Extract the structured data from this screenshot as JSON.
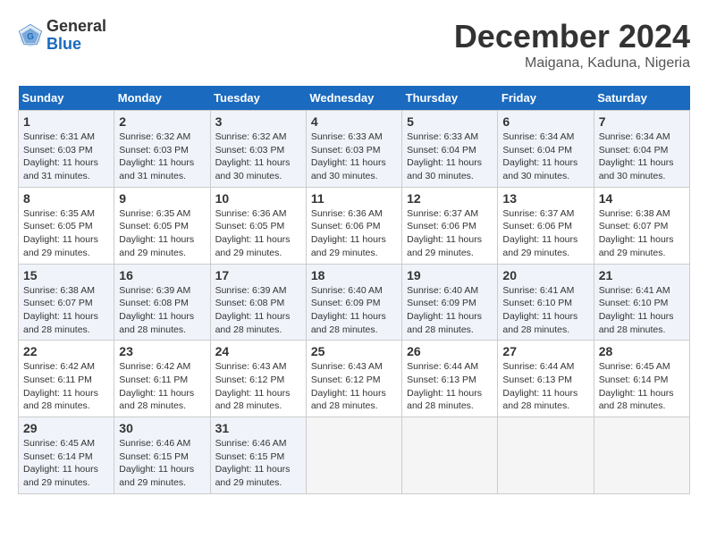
{
  "logo": {
    "general": "General",
    "blue": "Blue"
  },
  "title": {
    "month_year": "December 2024",
    "location": "Maigana, Kaduna, Nigeria"
  },
  "weekdays": [
    "Sunday",
    "Monday",
    "Tuesday",
    "Wednesday",
    "Thursday",
    "Friday",
    "Saturday"
  ],
  "weeks": [
    [
      {
        "day": "1",
        "sunrise": "6:31 AM",
        "sunset": "6:03 PM",
        "daylight": "11 hours and 31 minutes."
      },
      {
        "day": "2",
        "sunrise": "6:32 AM",
        "sunset": "6:03 PM",
        "daylight": "11 hours and 31 minutes."
      },
      {
        "day": "3",
        "sunrise": "6:32 AM",
        "sunset": "6:03 PM",
        "daylight": "11 hours and 30 minutes."
      },
      {
        "day": "4",
        "sunrise": "6:33 AM",
        "sunset": "6:03 PM",
        "daylight": "11 hours and 30 minutes."
      },
      {
        "day": "5",
        "sunrise": "6:33 AM",
        "sunset": "6:04 PM",
        "daylight": "11 hours and 30 minutes."
      },
      {
        "day": "6",
        "sunrise": "6:34 AM",
        "sunset": "6:04 PM",
        "daylight": "11 hours and 30 minutes."
      },
      {
        "day": "7",
        "sunrise": "6:34 AM",
        "sunset": "6:04 PM",
        "daylight": "11 hours and 30 minutes."
      }
    ],
    [
      {
        "day": "8",
        "sunrise": "6:35 AM",
        "sunset": "6:05 PM",
        "daylight": "11 hours and 29 minutes."
      },
      {
        "day": "9",
        "sunrise": "6:35 AM",
        "sunset": "6:05 PM",
        "daylight": "11 hours and 29 minutes."
      },
      {
        "day": "10",
        "sunrise": "6:36 AM",
        "sunset": "6:05 PM",
        "daylight": "11 hours and 29 minutes."
      },
      {
        "day": "11",
        "sunrise": "6:36 AM",
        "sunset": "6:06 PM",
        "daylight": "11 hours and 29 minutes."
      },
      {
        "day": "12",
        "sunrise": "6:37 AM",
        "sunset": "6:06 PM",
        "daylight": "11 hours and 29 minutes."
      },
      {
        "day": "13",
        "sunrise": "6:37 AM",
        "sunset": "6:06 PM",
        "daylight": "11 hours and 29 minutes."
      },
      {
        "day": "14",
        "sunrise": "6:38 AM",
        "sunset": "6:07 PM",
        "daylight": "11 hours and 29 minutes."
      }
    ],
    [
      {
        "day": "15",
        "sunrise": "6:38 AM",
        "sunset": "6:07 PM",
        "daylight": "11 hours and 28 minutes."
      },
      {
        "day": "16",
        "sunrise": "6:39 AM",
        "sunset": "6:08 PM",
        "daylight": "11 hours and 28 minutes."
      },
      {
        "day": "17",
        "sunrise": "6:39 AM",
        "sunset": "6:08 PM",
        "daylight": "11 hours and 28 minutes."
      },
      {
        "day": "18",
        "sunrise": "6:40 AM",
        "sunset": "6:09 PM",
        "daylight": "11 hours and 28 minutes."
      },
      {
        "day": "19",
        "sunrise": "6:40 AM",
        "sunset": "6:09 PM",
        "daylight": "11 hours and 28 minutes."
      },
      {
        "day": "20",
        "sunrise": "6:41 AM",
        "sunset": "6:10 PM",
        "daylight": "11 hours and 28 minutes."
      },
      {
        "day": "21",
        "sunrise": "6:41 AM",
        "sunset": "6:10 PM",
        "daylight": "11 hours and 28 minutes."
      }
    ],
    [
      {
        "day": "22",
        "sunrise": "6:42 AM",
        "sunset": "6:11 PM",
        "daylight": "11 hours and 28 minutes."
      },
      {
        "day": "23",
        "sunrise": "6:42 AM",
        "sunset": "6:11 PM",
        "daylight": "11 hours and 28 minutes."
      },
      {
        "day": "24",
        "sunrise": "6:43 AM",
        "sunset": "6:12 PM",
        "daylight": "11 hours and 28 minutes."
      },
      {
        "day": "25",
        "sunrise": "6:43 AM",
        "sunset": "6:12 PM",
        "daylight": "11 hours and 28 minutes."
      },
      {
        "day": "26",
        "sunrise": "6:44 AM",
        "sunset": "6:13 PM",
        "daylight": "11 hours and 28 minutes."
      },
      {
        "day": "27",
        "sunrise": "6:44 AM",
        "sunset": "6:13 PM",
        "daylight": "11 hours and 28 minutes."
      },
      {
        "day": "28",
        "sunrise": "6:45 AM",
        "sunset": "6:14 PM",
        "daylight": "11 hours and 28 minutes."
      }
    ],
    [
      {
        "day": "29",
        "sunrise": "6:45 AM",
        "sunset": "6:14 PM",
        "daylight": "11 hours and 29 minutes."
      },
      {
        "day": "30",
        "sunrise": "6:46 AM",
        "sunset": "6:15 PM",
        "daylight": "11 hours and 29 minutes."
      },
      {
        "day": "31",
        "sunrise": "6:46 AM",
        "sunset": "6:15 PM",
        "daylight": "11 hours and 29 minutes."
      },
      null,
      null,
      null,
      null
    ]
  ]
}
